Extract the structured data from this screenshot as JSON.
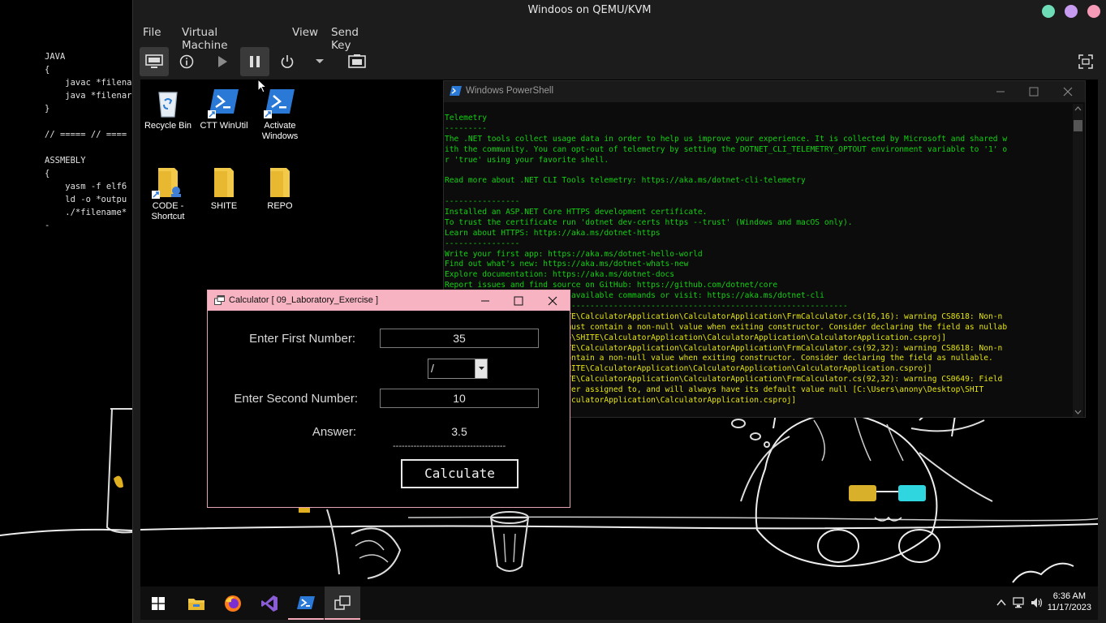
{
  "host_editor": {
    "lines": [
      "JAVA",
      "{",
      "    javac *filena",
      "    java *filenar",
      "}",
      "",
      "// ===== // ====",
      "",
      "ASSMEBLY",
      "{",
      "    yasm -f elf6",
      "    ld -o *outpu",
      "    ./*filename*",
      "-"
    ]
  },
  "vm_window": {
    "title": "Windoos on QEMU/KVM",
    "menu": [
      "File",
      "Virtual Machine",
      "View",
      "Send Key"
    ],
    "traffic_colors": [
      "#6fdcb8",
      "#c79cf0",
      "#f59bb8"
    ]
  },
  "desktop_icons": [
    {
      "label_lines": [
        "Recycle Bin"
      ],
      "icon": "recycle-bin-icon"
    },
    {
      "label_lines": [
        "CTT WinUtil"
      ],
      "icon": "powershell-shortcut-icon"
    },
    {
      "label_lines": [
        "Activate",
        "Windows"
      ],
      "icon": "powershell-shortcut-icon"
    },
    {
      "label_lines": [
        "CODE -",
        "Shortcut"
      ],
      "icon": "folder-shortcut-icon"
    },
    {
      "label_lines": [
        "SHITE"
      ],
      "icon": "folder-icon"
    },
    {
      "label_lines": [
        "REPO"
      ],
      "icon": "folder-icon"
    }
  ],
  "powershell": {
    "title": "Windows PowerShell",
    "lines": [
      {
        "c": "green",
        "t": "Telemetry"
      },
      {
        "c": "green",
        "t": "---------"
      },
      {
        "c": "green",
        "t": "The .NET tools collect usage data in order to help us improve your experience. It is collected by Microsoft and shared w"
      },
      {
        "c": "green",
        "t": "ith the community. You can opt-out of telemetry by setting the DOTNET_CLI_TELEMETRY_OPTOUT environment variable to '1' o"
      },
      {
        "c": "green",
        "t": "r 'true' using your favorite shell."
      },
      {
        "c": "green",
        "t": ""
      },
      {
        "c": "green",
        "t": "Read more about .NET CLI Tools telemetry: https://aka.ms/dotnet-cli-telemetry"
      },
      {
        "c": "green",
        "t": ""
      },
      {
        "c": "green",
        "t": "----------------"
      },
      {
        "c": "green",
        "t": "Installed an ASP.NET Core HTTPS development certificate."
      },
      {
        "c": "green",
        "t": "To trust the certificate run 'dotnet dev-certs https --trust' (Windows and macOS only)."
      },
      {
        "c": "green",
        "t": "Learn about HTTPS: https://aka.ms/dotnet-https"
      },
      {
        "c": "green",
        "t": "----------------"
      },
      {
        "c": "green",
        "t": "Write your first app: https://aka.ms/dotnet-hello-world"
      },
      {
        "c": "green",
        "t": "Find out what's new: https://aka.ms/dotnet-whats-new"
      },
      {
        "c": "green",
        "t": "Explore documentation: https://aka.ms/dotnet-docs"
      },
      {
        "c": "green",
        "t": "Report issues and find source on GitHub: https://github.com/dotnet/core"
      },
      {
        "c": "green",
        "t": "Use 'dotnet --help' to see available commands or visit: https://aka.ms/dotnet-cli"
      },
      {
        "c": "green",
        "t": "--------------------------------------------------------------------------------------"
      },
      {
        "c": "yellow",
        "t": "C:\\Users\\anony\\Desktop\\SHITE\\CalculatorApplication\\CalculatorApplication\\FrmCalculator.cs(16,16): warning CS8618: Non-n"
      },
      {
        "c": "yellow",
        "t": "ullable field 'operation' must contain a non-null value when exiting constructor. Consider declaring the field as nullab"
      },
      {
        "c": "yellow",
        "t": "le. [C:\\Users\\anony\\Desktop\\SHITE\\CalculatorApplication\\CalculatorApplication\\CalculatorApplication.csproj]"
      },
      {
        "c": "yellow",
        "t": "C:\\Users\\anony\\Desktop\\SHITE\\CalculatorApplication\\CalculatorApplication\\FrmCalculator.cs(92,32): warning CS8618: Non-n"
      },
      {
        "c": "yellow",
        "t": "ullable field 'cal' must contain a non-null value when exiting constructor. Consider declaring the field as nullable."
      },
      {
        "c": "yellow",
        "t": " [C:\\Users\\anony\\Desktop\\SHITE\\CalculatorApplication\\CalculatorApplication\\CalculatorApplication.csproj]"
      },
      {
        "c": "yellow",
        "t": "C:\\Users\\anony\\Desktop\\SHITE\\CalculatorApplication\\CalculatorApplication\\FrmCalculator.cs(92,32): warning CS0649: Field"
      },
      {
        "c": "yellow",
        "t": " 'FrmCalculator.cal' is never assigned to, and will always have its default value null [C:\\Users\\anony\\Desktop\\SHIT"
      },
      {
        "c": "yellow",
        "t": "E\\CalculatorApplication\\CalculatorApplication\\CalculatorApplication.csproj]"
      }
    ]
  },
  "calculator": {
    "title": "Calculator [ 09_Laboratory_Exercise ]",
    "first_label": "Enter First Number:",
    "first_value": "35",
    "operator_value": "/",
    "second_label": "Enter Second Number:",
    "second_value": "10",
    "answer_label": "Answer:",
    "answer_value": "3.5",
    "separator": "--------------------------------------",
    "calculate_label": "Calculate"
  },
  "taskbar": {
    "time": "6:36 AM",
    "date": "11/17/2023",
    "apps": [
      "start-icon",
      "file-explorer-icon",
      "firefox-icon",
      "visual-studio-icon",
      "powershell-icon",
      "calculator-app-icon"
    ]
  }
}
